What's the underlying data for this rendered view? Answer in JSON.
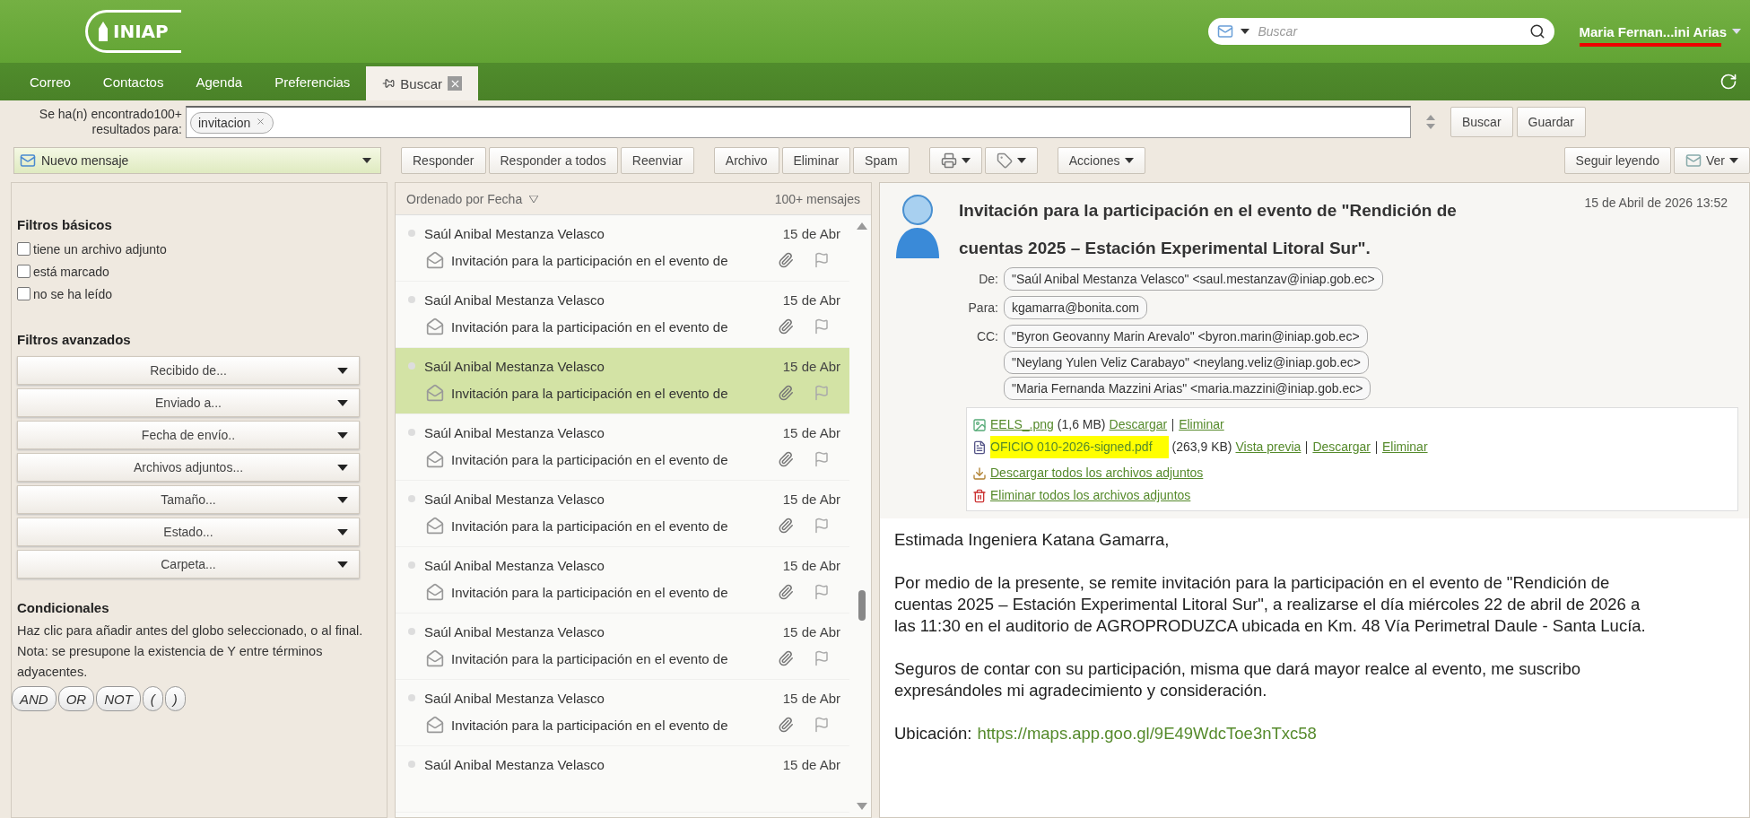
{
  "header": {
    "logo_text": "INIAP",
    "search": {
      "placeholder": "Buscar"
    },
    "user": "Maria Fernan...ini Arias"
  },
  "tabs": [
    {
      "label": "Correo",
      "kind": "app",
      "selected": false
    },
    {
      "label": "Contactos",
      "kind": "app",
      "selected": false
    },
    {
      "label": "Agenda",
      "kind": "app",
      "selected": false
    },
    {
      "label": "Preferencias",
      "kind": "app",
      "selected": false
    },
    {
      "label": "Buscar",
      "kind": "search",
      "selected": true
    }
  ],
  "search_bar": {
    "label_lines": [
      "Se ha(n) encontrado100+",
      "resultados para:"
    ],
    "tokens": [
      "invitacion"
    ],
    "buttons": [
      "Buscar",
      "Guardar"
    ]
  },
  "toolbar": {
    "new_message": "Nuevo mensaje",
    "button_groups": [
      [
        {
          "kind": "text",
          "label": "Responder"
        },
        {
          "kind": "text",
          "label": "Responder a todos"
        },
        {
          "kind": "text",
          "label": "Reenviar"
        }
      ],
      [
        {
          "kind": "text",
          "label": "Archivo"
        },
        {
          "kind": "text",
          "label": "Eliminar"
        },
        {
          "kind": "text",
          "label": "Spam"
        }
      ],
      [
        {
          "kind": "print"
        },
        {
          "kind": "tag"
        }
      ],
      [
        {
          "kind": "menu",
          "label": "Acciones"
        }
      ]
    ],
    "right": [
      {
        "kind": "text",
        "label": "Seguir leyendo"
      },
      {
        "kind": "view",
        "label": "Ver"
      }
    ]
  },
  "filters": {
    "basic_title": "Filtros básicos",
    "basic": [
      {
        "label": "tiene un archivo adjunto",
        "checked": false
      },
      {
        "label": "está marcado",
        "checked": false
      },
      {
        "label": "no se ha leído",
        "checked": false
      }
    ],
    "advanced_title": "Filtros avanzados",
    "advanced": [
      "Recibido de...",
      "Enviado a...",
      "Fecha de envío..",
      "Archivos adjuntos...",
      "Tamaño...",
      "Estado...",
      "Carpeta..."
    ],
    "conditional_title": "Condicionales",
    "conditional_note": "Haz clic para añadir antes del globo seleccionado, o al final. Nota: se presupone la existencia de Y entre términos adyacentes.",
    "operators": [
      "AND",
      "OR",
      "NOT",
      "(",
      ")"
    ]
  },
  "list": {
    "sort_label": "Ordenado por Fecha",
    "count": "100+ mensajes",
    "messages": [
      {
        "sender": "Saúl Anibal Mestanza Velasco",
        "date": "15 de Abr",
        "subject": "Invitación para la participación en el evento de",
        "selected": false
      },
      {
        "sender": "Saúl Anibal Mestanza Velasco",
        "date": "15 de Abr",
        "subject": "Invitación para la participación en el evento de",
        "selected": false
      },
      {
        "sender": "Saúl Anibal Mestanza Velasco",
        "date": "15 de Abr",
        "subject": "Invitación para la participación en el evento de",
        "selected": true
      },
      {
        "sender": "Saúl Anibal Mestanza Velasco",
        "date": "15 de Abr",
        "subject": "Invitación para la participación en el evento de",
        "selected": false
      },
      {
        "sender": "Saúl Anibal Mestanza Velasco",
        "date": "15 de Abr",
        "subject": "Invitación para la participación en el evento de",
        "selected": false
      },
      {
        "sender": "Saúl Anibal Mestanza Velasco",
        "date": "15 de Abr",
        "subject": "Invitación para la participación en el evento de",
        "selected": false
      },
      {
        "sender": "Saúl Anibal Mestanza Velasco",
        "date": "15 de Abr",
        "subject": "Invitación para la participación en el evento de",
        "selected": false
      },
      {
        "sender": "Saúl Anibal Mestanza Velasco",
        "date": "15 de Abr",
        "subject": "Invitación para la participación en el evento de",
        "selected": false
      },
      {
        "sender": "Saúl Anibal Mestanza Velasco",
        "date": "15 de Abr",
        "selected": false
      }
    ]
  },
  "message": {
    "subject": "Invitación para la participación en el evento de \"Rendición de cuentas 2025 – Estación Experimental Litoral Sur\".",
    "date": "15 de Abril de 2026 13:52",
    "recipients": [
      {
        "label": "De:",
        "addresses": [
          "\"Saúl Anibal Mestanza Velasco\" <saul.mestanzav@iniap.gob.ec>"
        ]
      },
      {
        "label": "Para:",
        "addresses": [
          "kgamarra@bonita.com"
        ]
      },
      {
        "label": "CC:",
        "addresses": [
          "\"Byron Geovanny Marin Arevalo\" <byron.marin@iniap.gob.ec>",
          "\"Neylang Yulen Veliz Carabayo\" <neylang.veliz@iniap.gob.ec>",
          "\"Maria Fernanda Mazzini Arias\" <maria.mazzini@iniap.gob.ec>"
        ]
      }
    ],
    "attachments": {
      "files": [
        {
          "kind": "image",
          "name": "EELS_.png",
          "size": "(1,6 MB)",
          "links": [
            "Descargar",
            "Eliminar"
          ],
          "highlighted": false
        },
        {
          "kind": "document",
          "name": "OFICIO 010-2026-signed.pdf",
          "size": "(263,9 KB)",
          "links": [
            "Vista previa",
            "Descargar",
            "Eliminar"
          ],
          "highlighted": true
        }
      ],
      "actions": [
        {
          "kind": "download",
          "label": "Descargar todos los archivos adjuntos"
        },
        {
          "kind": "delete",
          "label": "Eliminar todos los archivos adjuntos"
        }
      ]
    },
    "body": [
      {
        "kind": "text",
        "text": "Estimada Ingeniera Katana Gamarra,"
      },
      {
        "kind": "text",
        "text": "Por medio de la presente, se remite invitación para la participación en el evento de \"Rendición de cuentas 2025 – Estación Experimental Litoral Sur\", a realizarse el día miércoles 22 de abril de 2026 a las 11:30 en el auditorio de AGROPRODUZCA ubicada en Km. 48 Vía Perimetral Daule - Santa Lucía."
      },
      {
        "kind": "text",
        "text": "Seguros de contar con su participación, misma que dará mayor realce al evento, me suscribo expresándoles mi agradecimiento y consideración."
      },
      {
        "kind": "link",
        "label": "Ubicación:",
        "url": "https://maps.app.goo.gl/9E49WdcToe3nTxc58"
      }
    ]
  }
}
